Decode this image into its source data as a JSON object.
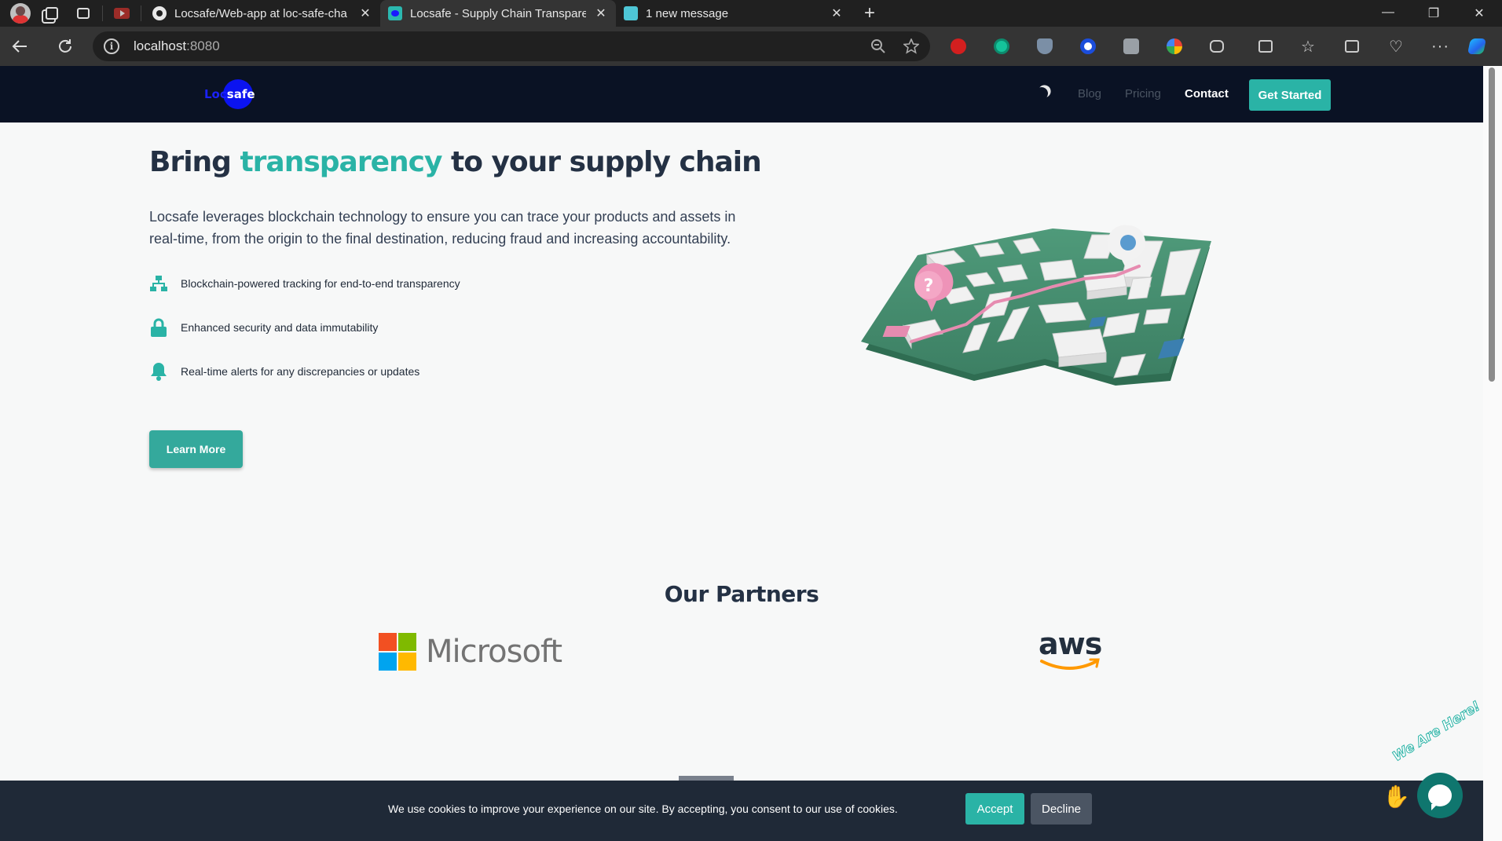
{
  "browser": {
    "tabs": [
      {
        "title": "Locsafe/Web-app at loc-safe-cha",
        "favicon": "github-icon"
      },
      {
        "title": "Locsafe - Supply Chain Transparen",
        "favicon": "locsafe-icon",
        "active": true
      },
      {
        "title": "1 new message",
        "favicon": "message-icon"
      }
    ],
    "url_host": "localhost",
    "url_port": ":8080"
  },
  "nav": {
    "logo_loc": "Loc",
    "logo_safe": "safe",
    "links": [
      "Blog",
      "Pricing",
      "Contact"
    ],
    "cta": "Get Started"
  },
  "hero": {
    "title_pre": "Bring ",
    "title_highlight": "transparency",
    "title_post": " to your supply chain",
    "subtitle": "Locsafe leverages blockchain technology to ensure you can trace your products and assets in real-time, from the origin to the final destination, reducing fraud and increasing accountability.",
    "features": [
      {
        "icon": "network-icon",
        "text": "Blockchain-powered tracking for end-to-end transparency"
      },
      {
        "icon": "lock-icon",
        "text": "Enhanced security and data immutability"
      },
      {
        "icon": "bell-icon",
        "text": "Real-time alerts for any discrepancies or updates"
      }
    ],
    "cta": "Learn More"
  },
  "partners": {
    "title": "Our Partners",
    "logos": [
      {
        "name": "Microsoft"
      },
      {
        "name": "aws"
      }
    ]
  },
  "cookie": {
    "text": "We use cookies to improve your experience on our site. By accepting, you consent to our use of cookies.",
    "accept": "Accept",
    "decline": "Decline"
  },
  "chat": {
    "tagline": "We Are Here!"
  },
  "colors": {
    "accent": "#2ab3a6",
    "nav_bg": "#0a1224",
    "cookie_bg": "#1f2937"
  }
}
